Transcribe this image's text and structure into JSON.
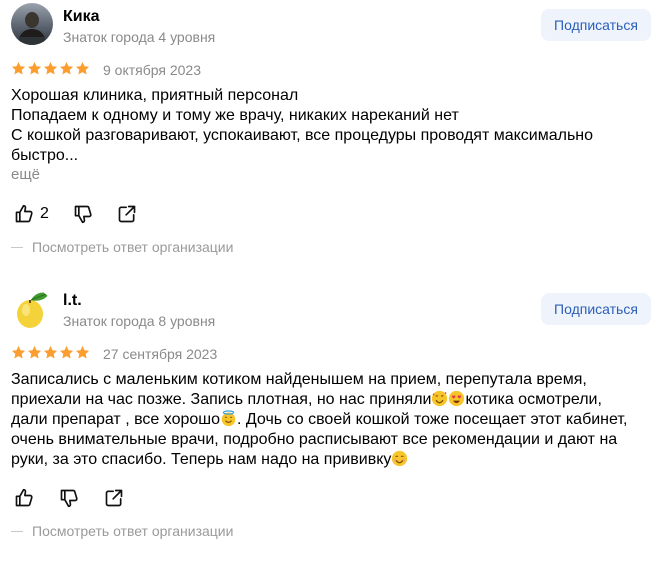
{
  "colors": {
    "star": "#fc9e2e",
    "subscribe_bg": "#eef3fc",
    "subscribe_text": "#2b5fb8",
    "muted_text": "#8a8a8a"
  },
  "reviews": [
    {
      "author": "Кика",
      "level": "Знаток города 4 уровня",
      "subscribe_label": "Подписаться",
      "rating": 5,
      "date": "9 октября 2023",
      "text_lines": [
        "Хорошая клиника, приятный персонал",
        "Попадаем к одному и тому же врачу, никаких нареканий нет",
        "С кошкой разговаривают, успокаивают, все процедуры проводят максимально",
        "быстро..."
      ],
      "more_label": "ещё",
      "likes": "2",
      "org_reply_label": "Посмотреть ответ организации",
      "avatar_icon": "user-photo-avatar"
    },
    {
      "author": "l.t.",
      "level": "Знаток города 8 уровня",
      "subscribe_label": "Подписаться",
      "rating": 5,
      "date": "27 сентября 2023",
      "text_lines": [
        "Записались с маленьким котиком найденышем на прием, перепутала время,",
        "приехали на час позже. Запись плотная, но нас приняли",
        "котика осмотрели,",
        "дали препарат , все хорошо",
        ". Дочь со своей кошкой тоже посещает этот кабинет,",
        "очень внимательные врачи, подробно расписывают все рекомендации и дают на",
        "руки, за это спасибо. Теперь нам надо на прививку"
      ],
      "org_reply_label": "Посмотреть ответ организации",
      "avatar_icon": "lemon-avatar"
    }
  ]
}
